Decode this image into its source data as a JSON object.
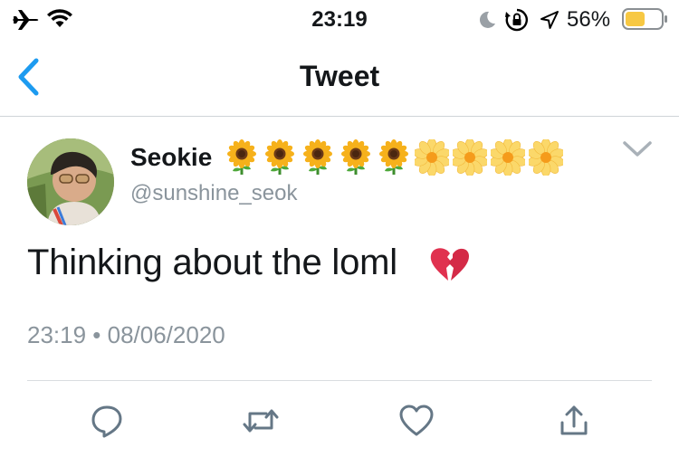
{
  "status_bar": {
    "time": "23:19",
    "battery_percent": "56%",
    "battery_level": 0.56,
    "battery_color": "#f7c843",
    "icons": [
      "airplane-icon",
      "wifi-icon",
      "moon-icon",
      "rotation-lock-icon",
      "location-icon",
      "battery-icon"
    ]
  },
  "nav": {
    "back_icon": "chevron-left-icon",
    "title": "Tweet",
    "accent_color": "#1d9bf0"
  },
  "tweet": {
    "display_name": "Seokie",
    "name_emojis": [
      "🌻",
      "🌻",
      "🌻",
      "🌻",
      "🌻",
      "🌼",
      "🌼",
      "🌼",
      "🌼"
    ],
    "handle": "@sunshine_seok",
    "text": "Thinking about the loml",
    "text_emoji": "💔",
    "timestamp": "23:19 • 08/06/2020",
    "menu_icon": "chevron-down-icon"
  },
  "actions": [
    {
      "name": "reply",
      "icon": "reply-icon"
    },
    {
      "name": "retweet",
      "icon": "retweet-icon"
    },
    {
      "name": "like",
      "icon": "heart-icon"
    },
    {
      "name": "share",
      "icon": "share-icon"
    }
  ]
}
